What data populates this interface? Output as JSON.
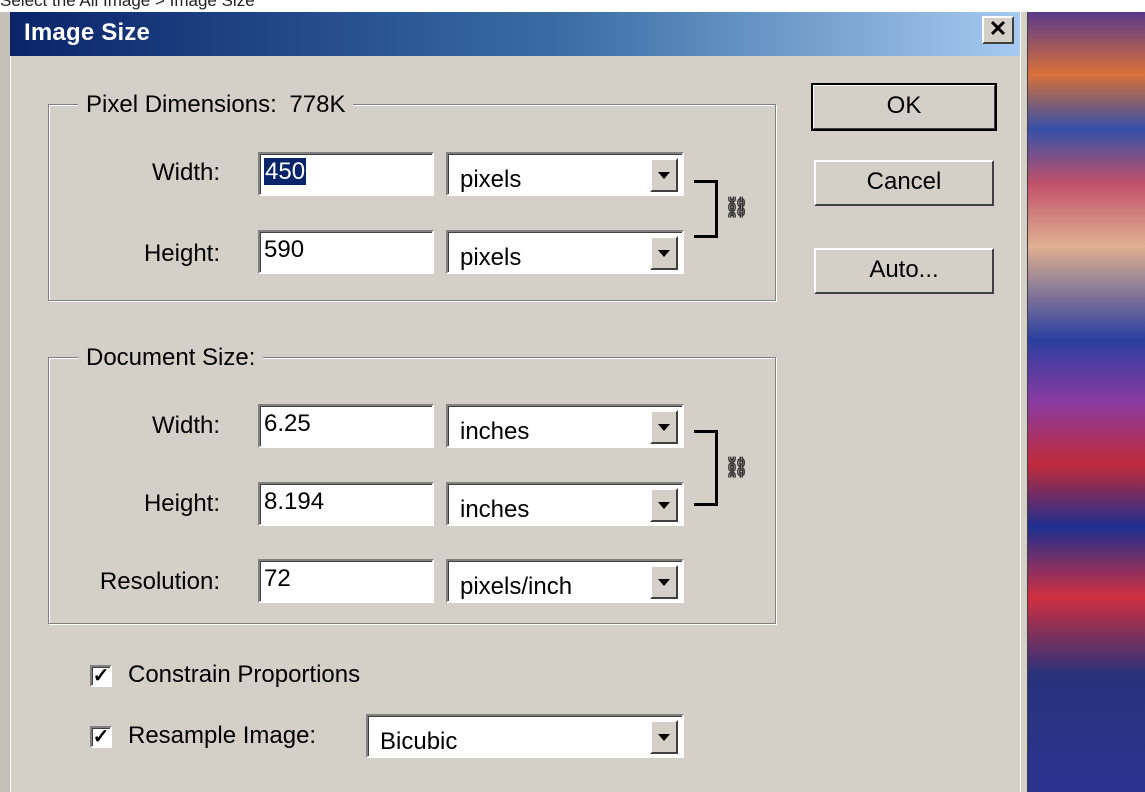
{
  "top_strip_text": "Select the All Image > Image Size",
  "dialog": {
    "title": "Image Size",
    "close_label": "✕"
  },
  "pixel_dimensions": {
    "label": "Pixel Dimensions:",
    "size": "778K",
    "width_label": "Width:",
    "width_value": "450",
    "width_unit": "pixels",
    "height_label": "Height:",
    "height_value": "590",
    "height_unit": "pixels"
  },
  "document_size": {
    "label": "Document Size:",
    "width_label": "Width:",
    "width_value": "6.25",
    "width_unit": "inches",
    "height_label": "Height:",
    "height_value": "8.194",
    "height_unit": "inches",
    "resolution_label": "Resolution:",
    "resolution_value": "72",
    "resolution_unit": "pixels/inch"
  },
  "buttons": {
    "ok": "OK",
    "cancel": "Cancel",
    "auto": "Auto..."
  },
  "options": {
    "constrain_label": "Constrain Proportions",
    "constrain_checked": true,
    "resample_label": "Resample Image:",
    "resample_checked": true,
    "resample_method": "Bicubic"
  },
  "icons": {
    "link": "chain-link-icon",
    "dropdown": "chevron-down-icon",
    "check": "checkmark-icon"
  },
  "colors": {
    "title_gradient_start": "#0a246a",
    "title_gradient_end": "#a6caf0",
    "dialog_face": "#d4d0c8",
    "selection": "#0a246a"
  }
}
